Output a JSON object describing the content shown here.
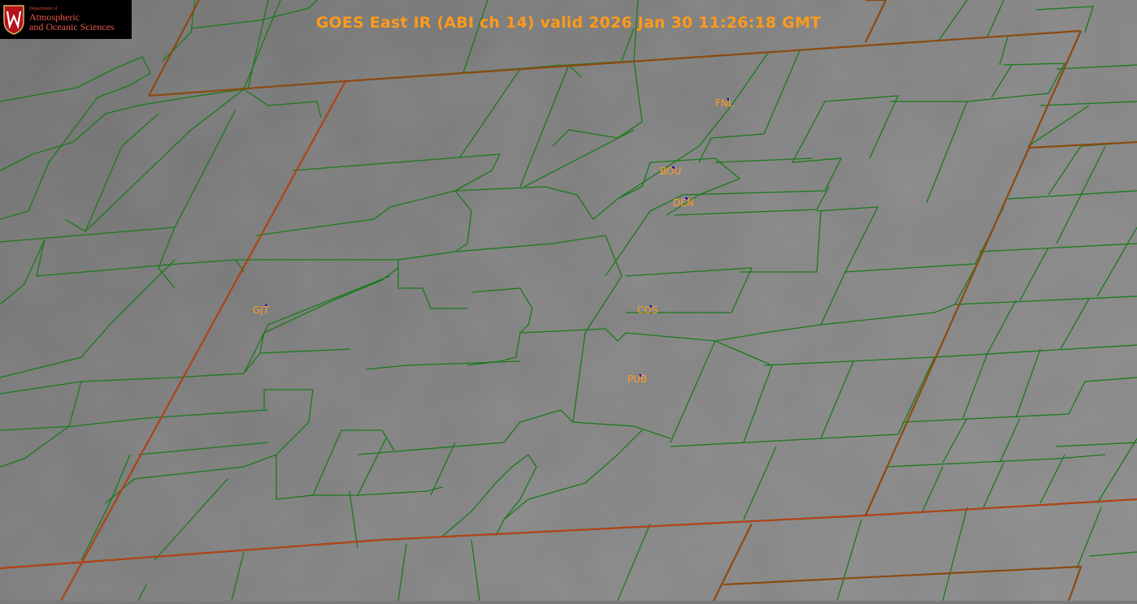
{
  "map": {
    "title": "GOES East IR (ABI ch 14) valid 2026 Jan 30 11:26:18 GMT",
    "logo": {
      "department": "Department of",
      "line1": "Atmospheric",
      "line2": "and Oceanic Sciences"
    },
    "stations": [
      {
        "id": "FNL"
      },
      {
        "id": "BOU"
      },
      {
        "id": "DEN"
      },
      {
        "id": "GJT"
      },
      {
        "id": "COS"
      },
      {
        "id": "PUB"
      }
    ],
    "colors": {
      "county_lines": "#1a7a1a",
      "state_lines": "#8b4a10",
      "state_lines_highlight": "#d43a1a",
      "label": "#ff9d1f",
      "station_marker": "#1414d0"
    }
  }
}
